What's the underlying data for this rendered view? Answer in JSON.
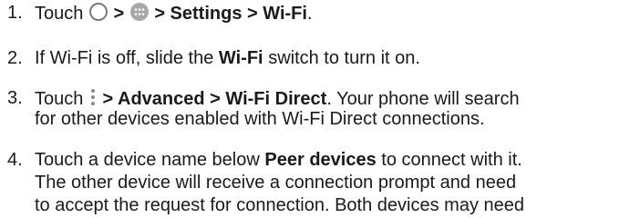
{
  "steps": [
    {
      "number": "1.",
      "line1": {
        "t1": "Touch",
        "icon1": "home-circle-icon",
        "sep1": ">",
        "icon2": "apps-grid-icon",
        "b1": "> Settings > Wi-Fi",
        "t2": "."
      }
    },
    {
      "number": "2.",
      "line1": {
        "t1": "If Wi-Fi is off, slide the",
        "b1": "Wi-Fi",
        "t2": "switch to turn it on."
      }
    },
    {
      "number": "3.",
      "line1": {
        "t1": "Touch",
        "icon1": "more-options-icon",
        "b1": "> Advanced > Wi-Fi Direct",
        "t2": ". Your phone will search"
      },
      "line2": "for other devices enabled with Wi-Fi Direct connections."
    },
    {
      "number": "4.",
      "line1": {
        "t1": "Touch a device name below",
        "b1": "Peer devices",
        "t2": "to connect with it."
      },
      "line2": "The other device will receive a connection prompt and need",
      "line3": "to accept the request for connection. Both devices may need"
    }
  ]
}
